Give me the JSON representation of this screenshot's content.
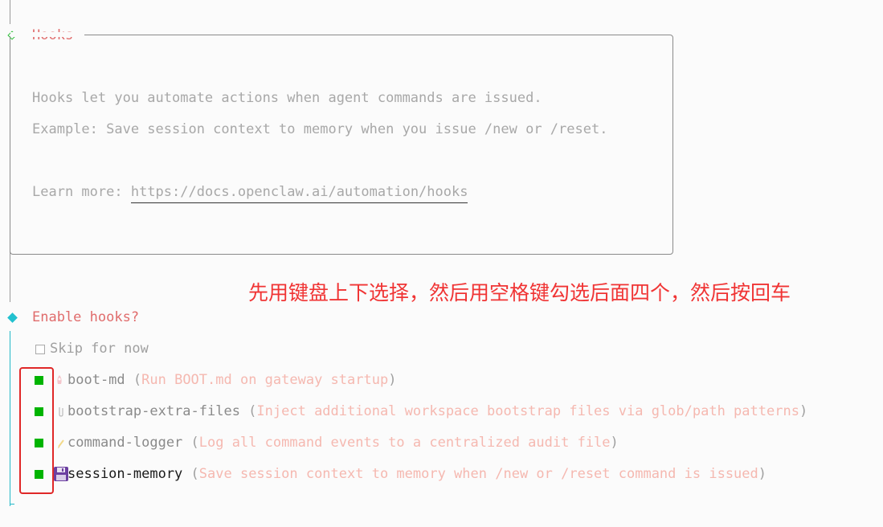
{
  "section": {
    "title": "Hooks",
    "lines": [
      "Hooks let you automate actions when agent commands are issued.",
      "Example: Save session context to memory when you issue /new or /reset."
    ],
    "learn_more_label": "Learn more: ",
    "learn_more_url": "https://docs.openclaw.ai/automation/hooks"
  },
  "annotation": "先用键盘上下选择，然后用空格键勾选后面四个，然后按回车",
  "prompt": {
    "question": "Enable hooks?",
    "skip_label": "Skip for now",
    "options": [
      {
        "name": "boot-md",
        "icon": "rocket-icon",
        "description": "Run BOOT.md on gateway startup",
        "checked": true
      },
      {
        "name": "bootstrap-extra-files",
        "icon": "paperclip-icon",
        "description": "Inject additional workspace bootstrap files via glob/path patterns",
        "checked": true
      },
      {
        "name": "command-logger",
        "icon": "memo-icon",
        "description": "Log all command events to a centralized audit file",
        "checked": true
      },
      {
        "name": "session-memory",
        "icon": "floppy-disk-icon",
        "description": "Save session context to memory when /new or /reset command is issued",
        "checked": true
      }
    ]
  },
  "colors": {
    "title_accent": "#e06c6c",
    "checkbox_on": "#00b400",
    "annotation": "#f03434",
    "cursor_line": "#22b8c8"
  }
}
